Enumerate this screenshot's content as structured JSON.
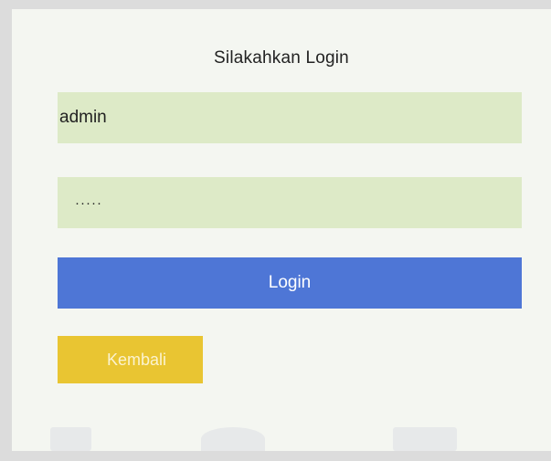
{
  "login_form": {
    "title": "Silakahkan Login",
    "username_value": "admin",
    "password_value": "·····",
    "login_button_label": "Login",
    "back_button_label": "Kembali"
  },
  "colors": {
    "panel_background": "#f4f6f1",
    "field_background": "#ddeac7",
    "login_button": "#4e76d6",
    "back_button": "#e9c532"
  }
}
